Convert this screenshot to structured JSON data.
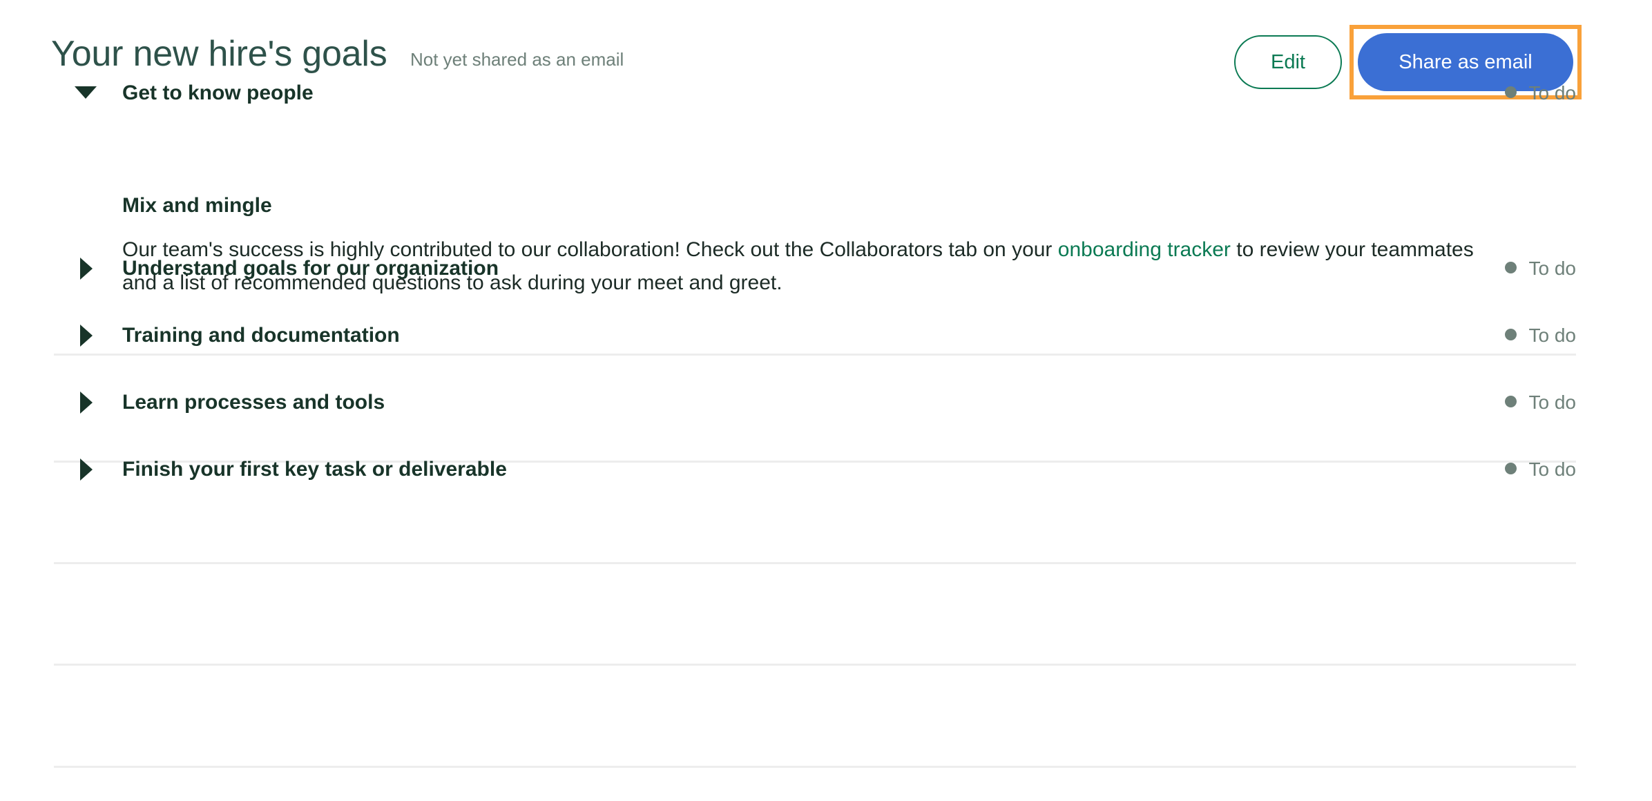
{
  "header": {
    "title": "Your new hire's goals",
    "share_status": "Not yet shared as an email",
    "edit_label": "Edit",
    "share_label": "Share as email",
    "title_color": "#2e524a",
    "share_button_color": "#3b6fd4",
    "focus_ring_color": "#f9a13a",
    "edit_border_color": "#0b7a53"
  },
  "goals": [
    {
      "title": "Get to know people",
      "status": "To do",
      "expanded": true,
      "caret": "caret-down-icon",
      "body": {
        "sub_title": "Mix and mingle",
        "text_before_link": "Our team's success is highly contributed to our collaboration! Check out the Collaborators tab on your ",
        "link_text": "onboarding tracker",
        "text_after_link": " to review your teammates and a list of recommended questions to ask during your meet and greet."
      }
    },
    {
      "title": "Understand goals for our organization",
      "status": "To do",
      "expanded": false,
      "caret": "caret-right-icon"
    },
    {
      "title": "Training and documentation",
      "status": "To do",
      "expanded": false,
      "caret": "caret-right-icon"
    },
    {
      "title": "Learn processes and tools",
      "status": "To do",
      "expanded": false,
      "caret": "caret-right-icon"
    },
    {
      "title": "Finish your first key task or deliverable",
      "status": "To do",
      "expanded": false,
      "caret": "caret-right-icon"
    }
  ],
  "status_colors": {
    "todo_dot": "#6e8079",
    "todo_text": "#6e8079"
  },
  "link_color": "#0b7a53",
  "divider_color": "#ededed"
}
